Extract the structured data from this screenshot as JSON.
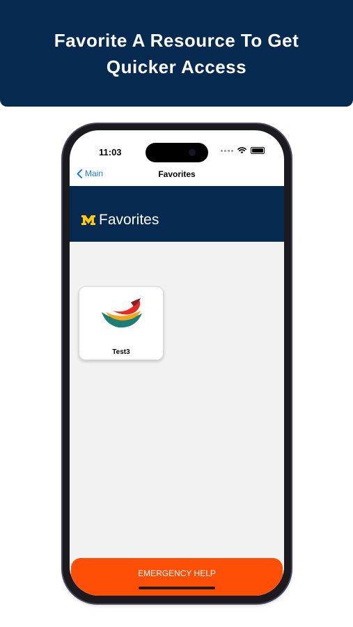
{
  "banner": {
    "title": "Favorite A Resource To Get Quicker Access"
  },
  "status_bar": {
    "time": "11:03"
  },
  "nav": {
    "back_label": "Main",
    "title": "Favorites"
  },
  "header": {
    "title": "Favorites",
    "logo_letter": "M"
  },
  "favorites": [
    {
      "label": "Test3",
      "icon": "test3-app-icon"
    }
  ],
  "emergency": {
    "label": "EMERGENCY HELP"
  },
  "colors": {
    "navy": "#06294f",
    "maize": "#ffcb05",
    "emergency": "#ff4f07",
    "link_blue": "#1a7cf2",
    "content_bg": "#f2f2f2"
  }
}
